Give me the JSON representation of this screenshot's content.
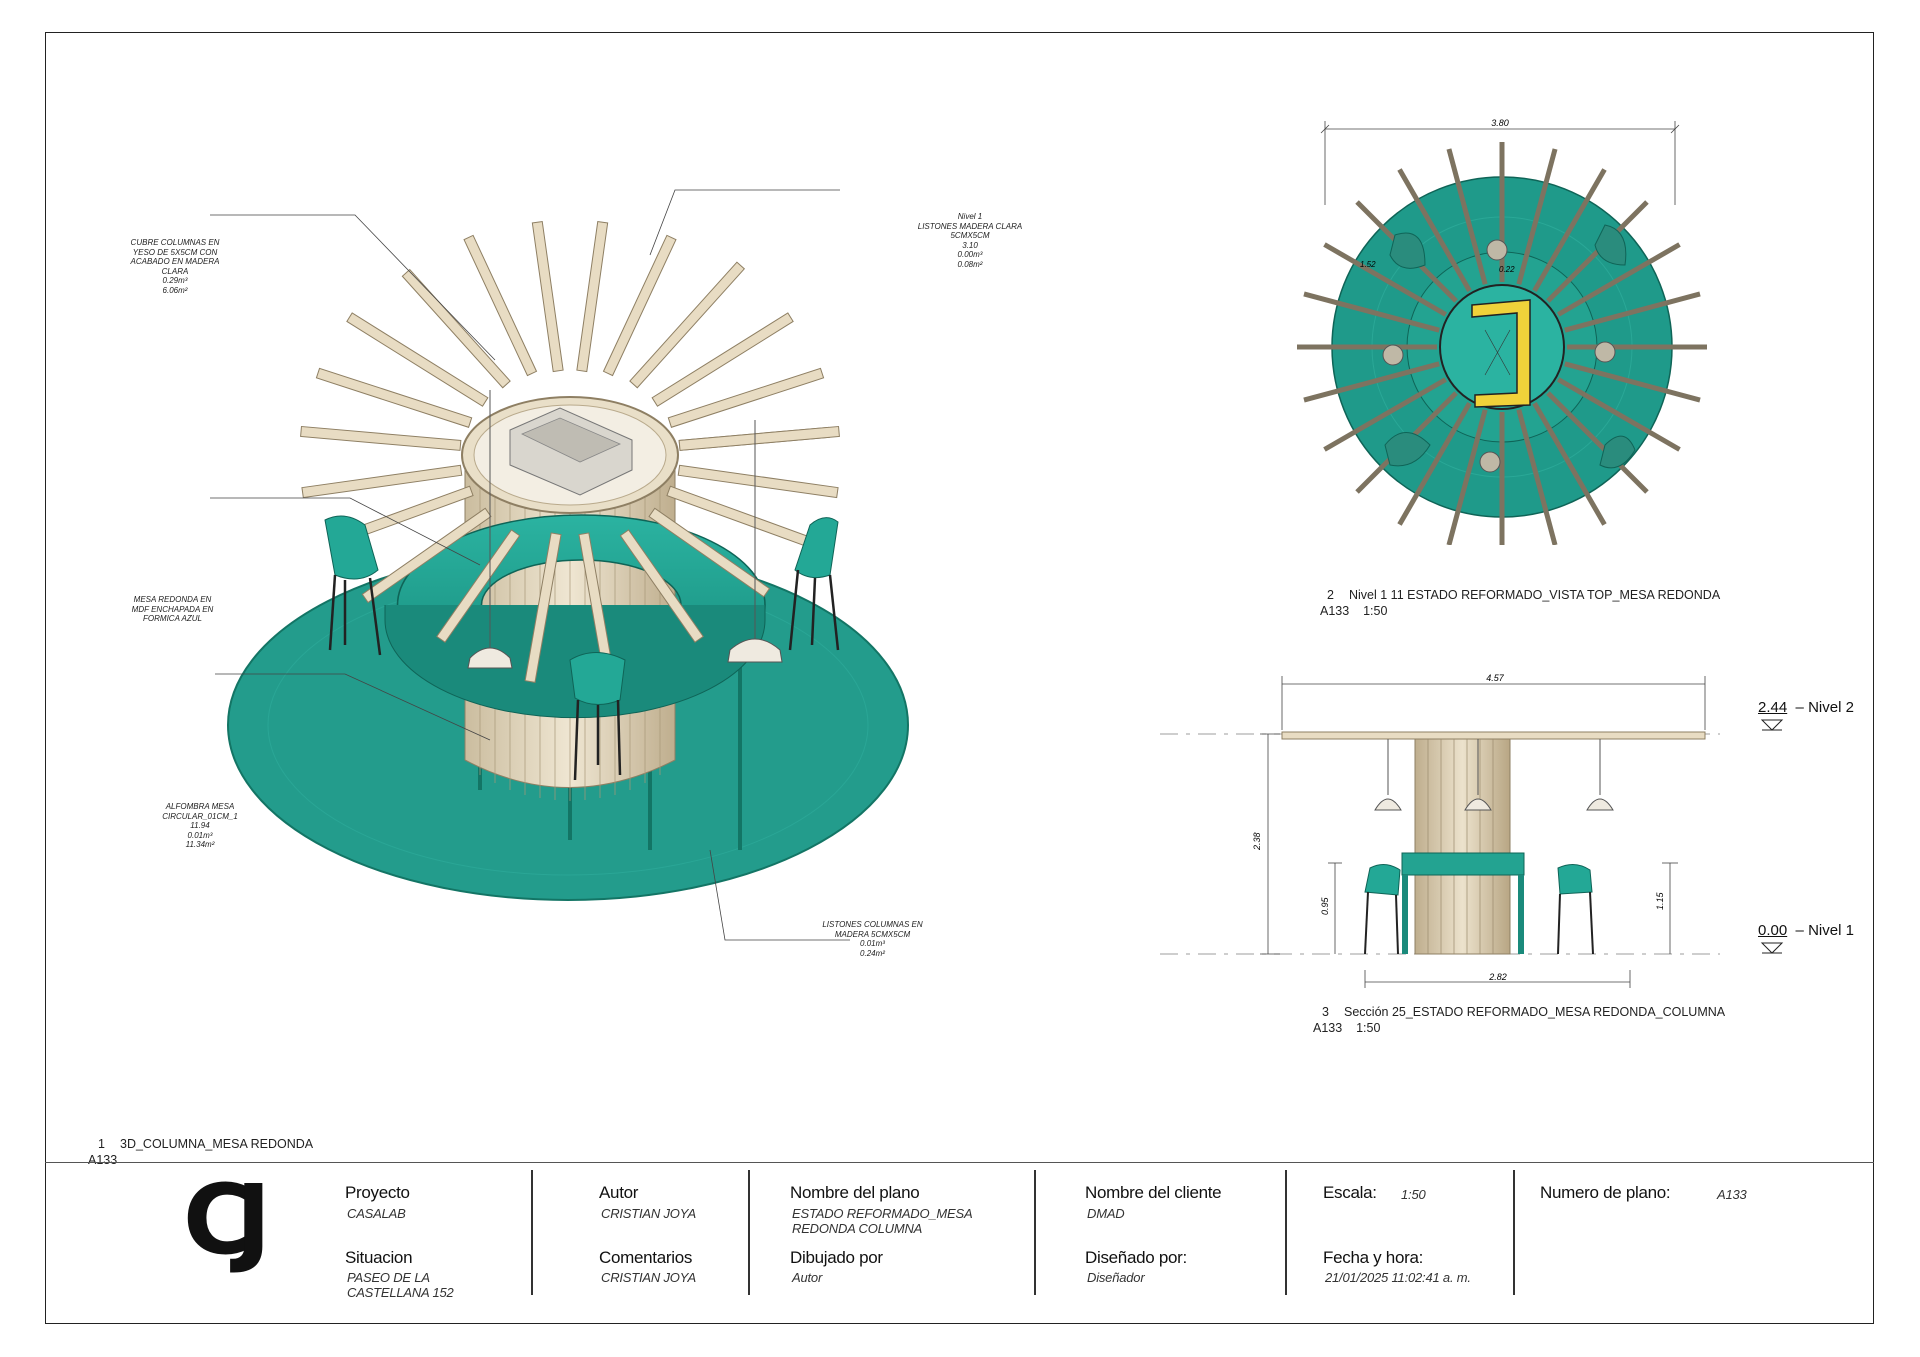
{
  "annotations": {
    "cubre_columnas": [
      "CUBRE COLUMNAS EN",
      "YESO DE 5X5CM CON",
      "ACABADO EN MADERA",
      "CLARA",
      "0.29m³",
      "6.06m²"
    ],
    "listones_madera": [
      "Nivel 1",
      "LISTONES MADERA CLARA",
      "5CMX5CM",
      "3.10",
      "0.00m³",
      "0.08m²"
    ],
    "mesa_redonda": [
      "MESA REDONDA EN",
      "MDF ENCHAPADA EN",
      "FORMICA AZUL"
    ],
    "alfombra": [
      "ALFOMBRA MESA",
      "CIRCULAR_01CM_1",
      "11.94",
      "0.01m³",
      "11.34m²"
    ],
    "listones_columnas": [
      "LISTONES COLUMNAS EN",
      "MADERA 5CMX5CM",
      "0.01m³",
      "0.24m²"
    ]
  },
  "views": {
    "view1": {
      "number": "1",
      "title": "3D_COLUMNA_MESA REDONDA",
      "sheet": "A133"
    },
    "view2": {
      "number": "2",
      "title": "Nivel 1 11 ESTADO REFORMADO_VISTA TOP_MESA REDONDA",
      "sheet": "A133",
      "scale": "1:50"
    },
    "view3": {
      "number": "3",
      "title": "Sección 25_ESTADO REFORMADO_MESA REDONDA_COLUMNA",
      "sheet": "A133",
      "scale": "1:50"
    }
  },
  "dimensions": {
    "top_width": "3.80",
    "top_small": "1.52",
    "top_inner": "0.22",
    "section_width": "4.57",
    "section_height": "2.38",
    "section_table": "0.95",
    "section_right": "1.15",
    "section_base": "2.82"
  },
  "levels": [
    {
      "value": "2.44",
      "name": "Nivel 2"
    },
    {
      "value": "0.00",
      "name": "Nivel 1"
    }
  ],
  "title_block": {
    "logo": "CJ",
    "proyecto_label": "Proyecto",
    "proyecto_value": "CASALAB",
    "situacion_label": "Situacion",
    "situacion_value": [
      "PASEO DE LA",
      "CASTELLANA 152"
    ],
    "autor_label": "Autor",
    "autor_value": "CRISTIAN JOYA",
    "comentarios_label": "Comentarios",
    "comentarios_value": "CRISTIAN JOYA",
    "nombre_plano_label": "Nombre del plano",
    "nombre_plano_value": [
      "ESTADO REFORMADO_MESA",
      "REDONDA COLUMNA"
    ],
    "dibujado_label": "Dibujado por",
    "dibujado_value": "Autor",
    "cliente_label": "Nombre del cliente",
    "cliente_value": "DMAD",
    "disenado_label": "Diseñado por:",
    "disenado_value": "Diseñador",
    "escala_label": "Escala:",
    "escala_value": "1:50",
    "fecha_label": "Fecha y hora:",
    "fecha_value": "21/01/2025 11:02:41 a. m.",
    "numero_label": "Numero de plano:",
    "numero_value": "A133"
  },
  "colors": {
    "teal": "#1f9a8a",
    "teal_dark": "#137565",
    "wood": "#d9cdb4",
    "yellow": "#f0d23a"
  }
}
